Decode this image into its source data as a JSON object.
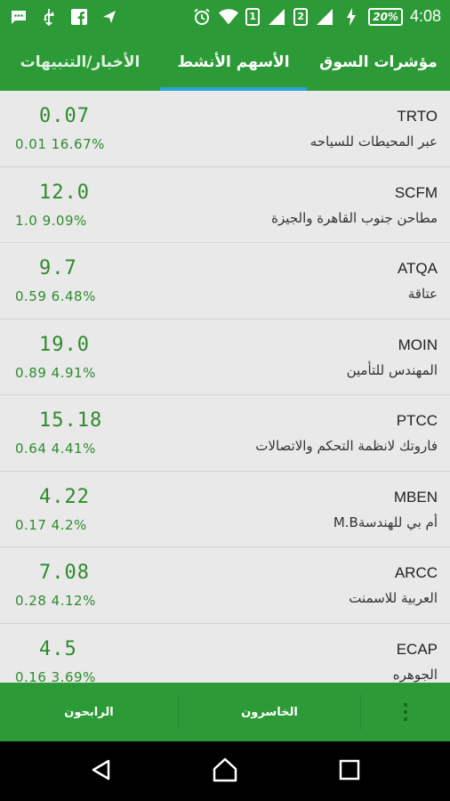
{
  "status": {
    "icons": [
      "message-icon",
      "usb-icon",
      "facebook-icon",
      "send-icon",
      "alarm-icon",
      "wifi-icon",
      "sim1-icon",
      "signal-icon",
      "sim2-icon",
      "signal-icon",
      "charging-icon"
    ],
    "sim1": "1",
    "sim2": "2",
    "battery": "20%",
    "time": "4:08"
  },
  "tabs": [
    {
      "label": "الأخبار/التنبيهات"
    },
    {
      "label": "الأسهم الأنشط"
    },
    {
      "label": "مؤشرات السوق"
    }
  ],
  "active_tab_index": 1,
  "stocks": [
    {
      "code": "TRTO",
      "name": "عبر المحيطات للسياحه",
      "price": "0.07",
      "change": "0.01 16.67%"
    },
    {
      "code": "SCFM",
      "name": "مطاحن جنوب القاهرة والجيزة",
      "price": "12.0",
      "change": "1.0 9.09%"
    },
    {
      "code": "ATQA",
      "name": "عتاقة",
      "price": "9.7",
      "change": "0.59 6.48%"
    },
    {
      "code": "MOIN",
      "name": "المهندس للتأمين",
      "price": "19.0",
      "change": "0.89 4.91%"
    },
    {
      "code": "PTCC",
      "name": "فاروتك لانظمة التحكم والاتصالات",
      "price": "15.18",
      "change": "0.64 4.41%"
    },
    {
      "code": "MBEN",
      "name": "أم بي للهندسةM.B",
      "price": "4.22",
      "change": "0.17 4.2%"
    },
    {
      "code": "ARCC",
      "name": "العربية للاسمنت",
      "price": "7.08",
      "change": "0.28 4.12%"
    },
    {
      "code": "ECAP",
      "name": "الجوهره",
      "price": "4.5",
      "change": "0.16 3.69%"
    }
  ],
  "bottom": {
    "gainers": "الرابحون",
    "losers": "الخاسرون",
    "more": "overflow-menu-icon"
  },
  "colors": {
    "primary": "#2c9b37",
    "accent": "#2aa4d8",
    "positive": "#2e8b2e"
  },
  "nav": [
    "back-icon",
    "home-icon",
    "recents-icon"
  ]
}
